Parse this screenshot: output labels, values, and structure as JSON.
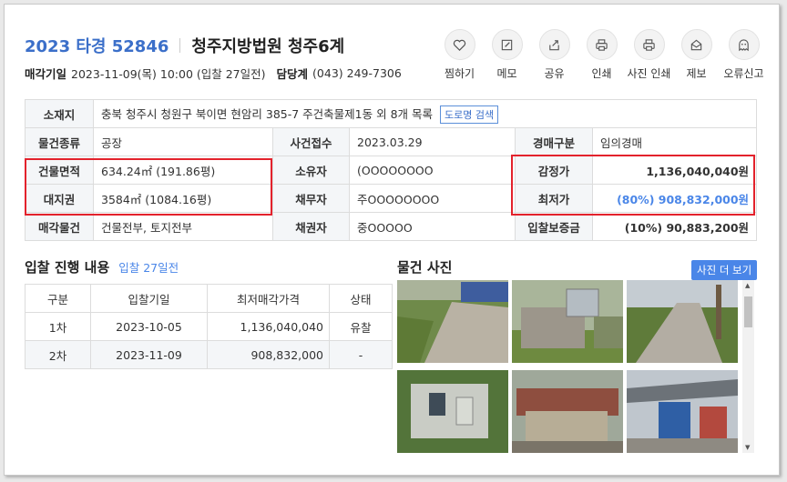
{
  "header": {
    "case_no": "2023 타경 52846",
    "court": "청주지방법원 청주6계",
    "sale_date_label": "매각기일",
    "sale_date_value": "2023-11-09(목) 10:00 (입찰 27일전)",
    "dept_label": "담당계",
    "dept_value": "(043) 249-7306"
  },
  "actions": [
    {
      "label": "찜하기",
      "icon": "heart-icon"
    },
    {
      "label": "메모",
      "icon": "memo-icon"
    },
    {
      "label": "공유",
      "icon": "share-icon"
    },
    {
      "label": "인쇄",
      "icon": "print-icon"
    },
    {
      "label": "사진 인쇄",
      "icon": "photo-print-icon"
    },
    {
      "label": "제보",
      "icon": "report-icon"
    },
    {
      "label": "오류신고",
      "icon": "error-report-icon"
    }
  ],
  "info": {
    "location_label": "소재지",
    "location_value": "충북 청주시 청원구 북이면 현암리 385-7 주건축물제1동 외 8개 목록",
    "road_search": "도로명 검색",
    "rows": [
      {
        "l1": "물건종류",
        "v1": "공장",
        "l2": "사건접수",
        "v2": "2023.03.29",
        "l3": "경매구분",
        "v3": "임의경매"
      },
      {
        "l1": "건물면적",
        "v1": "634.24㎡ (191.86평)",
        "l2": "소유자",
        "v2": "(OOOOOOOO",
        "l3": "감정가",
        "v3": "1,136,040,040원"
      },
      {
        "l1": "대지권",
        "v1": "3584㎡ (1084.16평)",
        "l2": "채무자",
        "v2": "주OOOOOOOO",
        "l3": "최저가",
        "v3": "(80%) 908,832,000원"
      },
      {
        "l1": "매각물건",
        "v1": "건물전부, 토지전부",
        "l2": "채권자",
        "v2": "중OOOOO",
        "l3": "입찰보증금",
        "v3": "(10%) 90,883,200원"
      }
    ]
  },
  "bidding": {
    "title": "입찰 진행 내용",
    "subtitle": "입찰 27일전",
    "columns": [
      "구분",
      "입찰기일",
      "최저매각가격",
      "상태"
    ],
    "rows": [
      {
        "round": "1차",
        "date": "2023-10-05",
        "price": "1,136,040,040",
        "status": "유찰"
      },
      {
        "round": "2차",
        "date": "2023-11-09",
        "price": "908,832,000",
        "status": "-"
      }
    ]
  },
  "photos": {
    "title": "물건 사진",
    "more_button": "사진 더 보기"
  },
  "colors": {
    "accent_blue": "#4a86e8",
    "highlight_red": "#e3222c"
  }
}
